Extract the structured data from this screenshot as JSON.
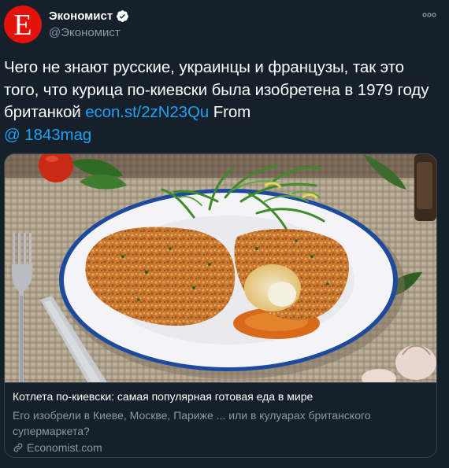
{
  "account": {
    "display_name": "Экономист",
    "handle": "@Экономист",
    "avatar_letter": "E",
    "avatar_color": "#e3120b"
  },
  "tweet": {
    "text_before_link": "Чего не знают русские, украинцы и французы, так это того, что курица по-киевски была изобретена в 1979 году британкой ",
    "link_text": "econ.st/2zN23Qu",
    "text_after_link": " From",
    "mention_text": "@ 1843mag"
  },
  "card": {
    "image_alt": "chicken-kiev-photo",
    "title": "Котлета по-киевски: самая популярная готовая еда в мире",
    "description": "Его изобрели в Киеве, Москве, Париже ... или в кулуарах британского супермаркета?",
    "source": "Economist.com"
  },
  "colors": {
    "background": "#15202b",
    "link": "#1da1f2",
    "secondary_text": "#8899a6",
    "border": "#38444d"
  },
  "icons": [
    "verified-badge-icon",
    "more-options-icon",
    "link-icon"
  ]
}
